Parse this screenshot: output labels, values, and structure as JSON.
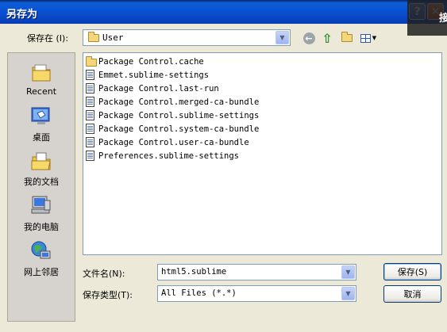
{
  "window": {
    "title": "另存为",
    "help_label": "?",
    "close_label": "✕",
    "overlay_char": "接"
  },
  "save_in": {
    "label": "保存在 (I):",
    "value": "User"
  },
  "toolbar": {
    "icons": [
      "back-icon",
      "up-folder-icon",
      "new-folder-icon",
      "view-menu-icon"
    ]
  },
  "places": [
    {
      "label": "Recent",
      "icon": "recent-icon"
    },
    {
      "label": "桌面",
      "icon": "desktop-icon"
    },
    {
      "label": "我的文档",
      "icon": "my-documents-icon"
    },
    {
      "label": "我的电脑",
      "icon": "my-computer-icon"
    },
    {
      "label": "网上邻居",
      "icon": "network-icon"
    }
  ],
  "files": [
    {
      "name": "Package Control.cache",
      "type": "folder"
    },
    {
      "name": "Emmet.sublime-settings",
      "type": "file"
    },
    {
      "name": "Package Control.last-run",
      "type": "file"
    },
    {
      "name": "Package Control.merged-ca-bundle",
      "type": "file"
    },
    {
      "name": "Package Control.sublime-settings",
      "type": "file"
    },
    {
      "name": "Package Control.system-ca-bundle",
      "type": "file"
    },
    {
      "name": "Package Control.user-ca-bundle",
      "type": "file"
    },
    {
      "name": "Preferences.sublime-settings",
      "type": "file"
    }
  ],
  "filename": {
    "label": "文件名(N):",
    "value": "html5.sublime"
  },
  "filetype": {
    "label": "保存类型(T):",
    "value": "All Files (*.*)"
  },
  "buttons": {
    "save": "保存(S)",
    "cancel": "取消"
  },
  "colors": {
    "titlebar": "#0A52D4",
    "dialog_bg": "#ECE9D8",
    "places_bg": "#D6D3CE",
    "border_blue": "#7F9DB9"
  }
}
